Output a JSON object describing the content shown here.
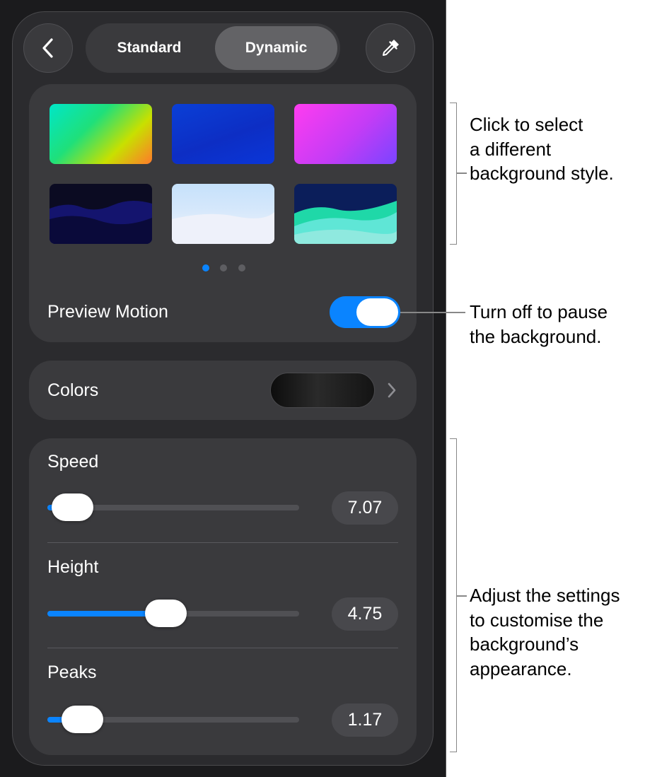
{
  "segmented": {
    "standard": "Standard",
    "dynamic": "Dynamic",
    "selected": "Dynamic"
  },
  "icons": {
    "back": "chevron-left-icon",
    "eyedropper": "eyedropper-icon",
    "colors_disclosure": "chevron-right-icon"
  },
  "styles": {
    "swatches": [
      {
        "name": "rainbow-gradient",
        "colors": [
          "#00e6c8",
          "#1fe07a",
          "#c8e000",
          "#ff7a2a"
        ]
      },
      {
        "name": "blue-gradient",
        "colors": [
          "#0a3fd6",
          "#0d2ec4",
          "#0a36d8"
        ]
      },
      {
        "name": "magenta-purple",
        "colors": [
          "#ff3cf0",
          "#c43cf6",
          "#7a44ff"
        ]
      },
      {
        "name": "dark-navy-hills",
        "colors": [
          "#0b0b22",
          "#14146e",
          "#0a0a3a"
        ]
      },
      {
        "name": "pale-blue-white",
        "colors": [
          "#c6e1fb",
          "#e7f0fb",
          "#f6f4fa"
        ]
      },
      {
        "name": "teal-hills",
        "colors": [
          "#0b1e5a",
          "#1fd8a8",
          "#5fe6d6"
        ]
      }
    ],
    "page_count": 3,
    "current_page": 1
  },
  "preview_motion": {
    "label": "Preview Motion",
    "on": true
  },
  "colors": {
    "label": "Colors"
  },
  "sliders": [
    {
      "label": "Speed",
      "value": "7.07",
      "fraction": 0.1
    },
    {
      "label": "Height",
      "value": "4.75",
      "fraction": 0.47
    },
    {
      "label": "Peaks",
      "value": "1.17",
      "fraction": 0.14
    }
  ],
  "callouts": {
    "background_style": [
      "Click to select",
      "a different",
      "background style."
    ],
    "preview_motion": [
      "Turn off to pause",
      "the background."
    ],
    "settings": [
      "Adjust the settings",
      "to customise the",
      "background’s",
      "appearance."
    ]
  },
  "theme": {
    "accent": "#0a84ff",
    "panel": "#2b2b2e",
    "card": "#3a3a3d"
  }
}
